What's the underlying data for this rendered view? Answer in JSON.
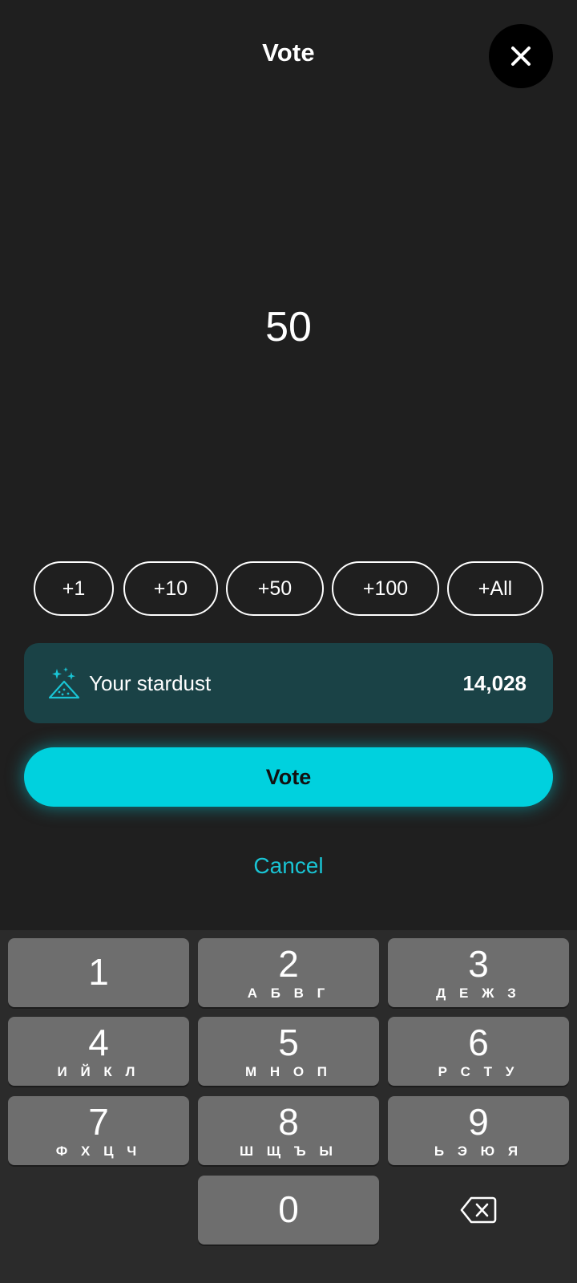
{
  "header": {
    "title": "Vote",
    "close_icon": "close-icon"
  },
  "amount": {
    "value": "50"
  },
  "quick_add": [
    {
      "label": "+1"
    },
    {
      "label": "+10"
    },
    {
      "label": "+50"
    },
    {
      "label": "+100"
    },
    {
      "label": "+All"
    }
  ],
  "stardust": {
    "icon": "stardust-icon",
    "label": "Your stardust",
    "value": "14,028",
    "background": "#1a4246",
    "icon_color": "#19c4d4"
  },
  "vote_button": {
    "label": "Vote",
    "color": "#00d1de"
  },
  "cancel": {
    "label": "Cancel",
    "color": "#19c4d4"
  },
  "keyboard": {
    "keys": [
      {
        "digit": "1",
        "letters": ""
      },
      {
        "digit": "2",
        "letters": "А Б В Г"
      },
      {
        "digit": "3",
        "letters": "Д Е Ж З"
      },
      {
        "digit": "4",
        "letters": "И Й К Л"
      },
      {
        "digit": "5",
        "letters": "М Н О П"
      },
      {
        "digit": "6",
        "letters": "Р С Т У"
      },
      {
        "digit": "7",
        "letters": "Ф Х Ц Ч"
      },
      {
        "digit": "8",
        "letters": "Ш Щ Ъ Ы"
      },
      {
        "digit": "9",
        "letters": "Ь Э Ю Я"
      },
      {
        "digit": "0",
        "letters": ""
      }
    ],
    "backspace_icon": "backspace-icon"
  }
}
